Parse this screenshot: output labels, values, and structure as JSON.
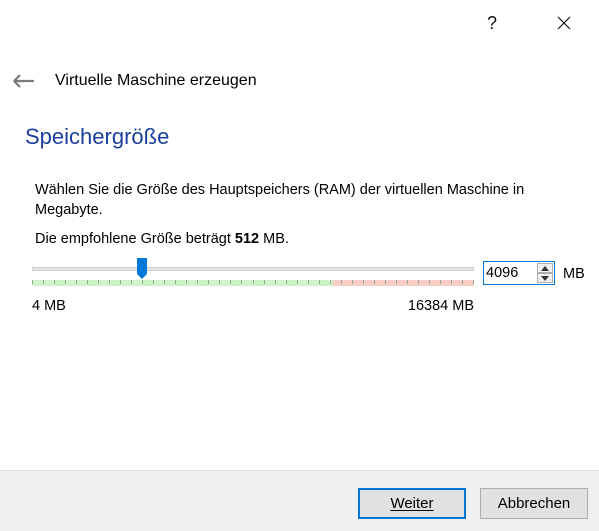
{
  "window": {
    "help_label": "?",
    "close_icon": "close-icon"
  },
  "wizard": {
    "title": "Virtuelle Maschine erzeugen",
    "back_icon": "arrow-left-icon"
  },
  "page": {
    "heading": "Speichergröße",
    "description": "Wählen Sie die Größe des Hauptspeichers (RAM) der virtuellen Maschine in Megabyte.",
    "recommended_prefix": "Die empfohlene Größe beträgt ",
    "recommended_value": "512",
    "recommended_suffix": " MB."
  },
  "memory": {
    "min": 4,
    "max": 16384,
    "value": 4096,
    "value_text": "4096",
    "unit": "MB",
    "min_label": "4 MB",
    "max_label": "16384 MB",
    "recommended_range_ratio": 0.68,
    "colors": {
      "green": "#ccf2c6",
      "red": "#f9cdc3",
      "thumb": "#0078d7",
      "heading": "#1b3f9a"
    }
  },
  "buttons": {
    "next": "Weiter",
    "cancel": "Abbrechen"
  }
}
